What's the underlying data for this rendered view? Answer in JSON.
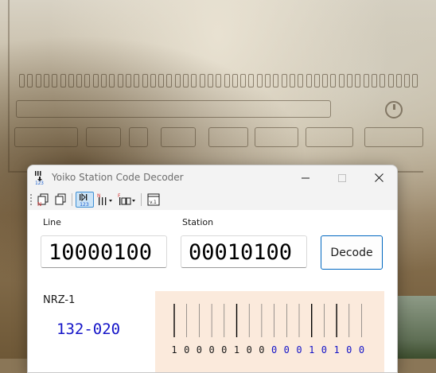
{
  "window": {
    "title": "Yoiko Station Code Decoder"
  },
  "toolbar": {
    "buttons": [
      {
        "icon": "copy-n-icon",
        "active": false
      },
      {
        "icon": "copy-icon",
        "active": false
      },
      {
        "icon": "numeric-mode-icon",
        "active": true
      },
      {
        "icon": "bit-order-dropdown-icon",
        "active": false
      },
      {
        "icon": "frame-format-dropdown-icon",
        "active": false
      },
      {
        "icon": "version-icon",
        "label": "v.1",
        "active": false
      }
    ]
  },
  "form": {
    "line_label": "Line",
    "line_value": "10000100",
    "station_label": "Station",
    "station_value": "00010100",
    "decode_label": "Decode"
  },
  "result": {
    "encoding": "NRZ-1",
    "decoded": "132-020",
    "bits": [
      "1",
      "0",
      "0",
      "0",
      "0",
      "1",
      "0",
      "0",
      "0",
      "0",
      "0",
      "1",
      "0",
      "1",
      "0",
      "0"
    ],
    "bit_colors": {
      "line": "#1a1a1a",
      "station": "#1414c8"
    }
  },
  "colors": {
    "accent": "#0067c0",
    "waveform_bg": "#fbeadc",
    "decoded_text": "#1414c8"
  }
}
